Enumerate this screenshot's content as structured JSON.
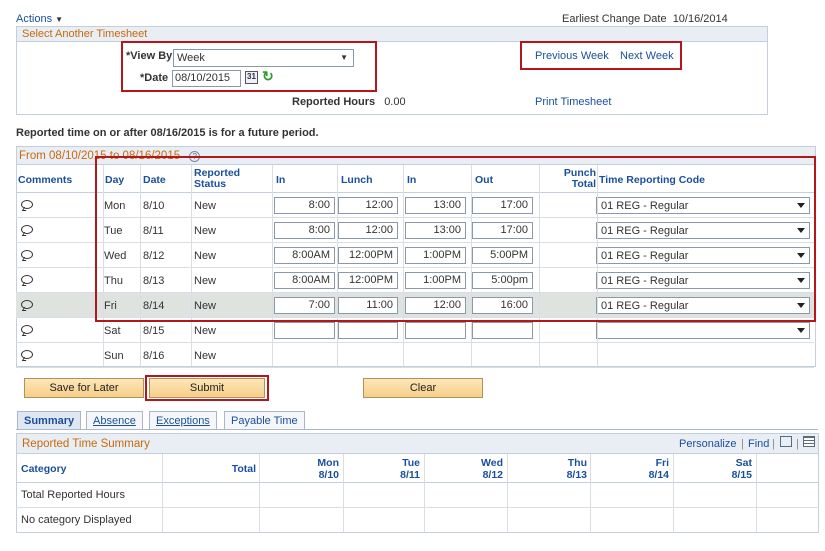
{
  "actions_label": "Actions",
  "earliest_change": {
    "label": "Earliest Change Date",
    "value": "10/16/2014"
  },
  "select_timesheet": {
    "title": "Select Another Timesheet",
    "view_by_label": "*View By",
    "view_by_value": "Week",
    "date_label": "*Date",
    "date_value": "08/10/2015",
    "previous_week": "Previous Week",
    "next_week": "Next Week",
    "reported_hours_label": "Reported Hours",
    "reported_hours_value": "0.00",
    "print_timesheet": "Print Timesheet"
  },
  "future_notice": "Reported time on or after 08/16/2015 is for a future period.",
  "period_title": "From 08/10/2015 to 08/16/2015",
  "columns": {
    "comments": "Comments",
    "day": "Day",
    "date": "Date",
    "reported_status": "Reported Status",
    "in": "In",
    "lunch": "Lunch",
    "in2": "In",
    "out": "Out",
    "punch_total": "Punch Total",
    "trc": "Time Reporting Code"
  },
  "rows": [
    {
      "day": "Mon",
      "date": "8/10",
      "status": "New",
      "in": "8:00",
      "lunch": "12:00",
      "in2": "13:00",
      "out": "17:00",
      "trc": "01 REG - Regular"
    },
    {
      "day": "Tue",
      "date": "8/11",
      "status": "New",
      "in": "8:00",
      "lunch": "12:00",
      "in2": "13:00",
      "out": "17:00",
      "trc": "01 REG - Regular"
    },
    {
      "day": "Wed",
      "date": "8/12",
      "status": "New",
      "in": "8:00AM",
      "lunch": "12:00PM",
      "in2": "1:00PM",
      "out": "5:00PM",
      "trc": "01 REG - Regular"
    },
    {
      "day": "Thu",
      "date": "8/13",
      "status": "New",
      "in": "8:00AM",
      "lunch": "12:00PM",
      "in2": "1:00PM",
      "out": "5:00pm",
      "trc": "01 REG - Regular"
    },
    {
      "day": "Fri",
      "date": "8/14",
      "status": "New",
      "in": "7:00",
      "lunch": "11:00",
      "in2": "12:00",
      "out": "16:00",
      "trc": "01 REG - Regular"
    },
    {
      "day": "Sat",
      "date": "8/15",
      "status": "New",
      "in": "",
      "lunch": "",
      "in2": "",
      "out": "",
      "trc": ""
    },
    {
      "day": "Sun",
      "date": "8/16",
      "status": "New"
    }
  ],
  "buttons": {
    "save_for_later": "Save for Later",
    "submit": "Submit",
    "clear": "Clear"
  },
  "tabs": [
    "Summary",
    "Absence",
    "Exceptions",
    "Payable Time"
  ],
  "summary": {
    "title": "Reported Time Summary",
    "personalize": "Personalize",
    "find": "Find",
    "category_header": "Category",
    "total_header": "Total",
    "day_headers": [
      {
        "day": "Mon",
        "date": "8/10"
      },
      {
        "day": "Tue",
        "date": "8/11"
      },
      {
        "day": "Wed",
        "date": "8/12"
      },
      {
        "day": "Thu",
        "date": "8/13"
      },
      {
        "day": "Fri",
        "date": "8/14"
      },
      {
        "day": "Sat",
        "date": "8/15"
      }
    ],
    "rows": [
      "Total Reported Hours",
      "No category Displayed"
    ]
  }
}
